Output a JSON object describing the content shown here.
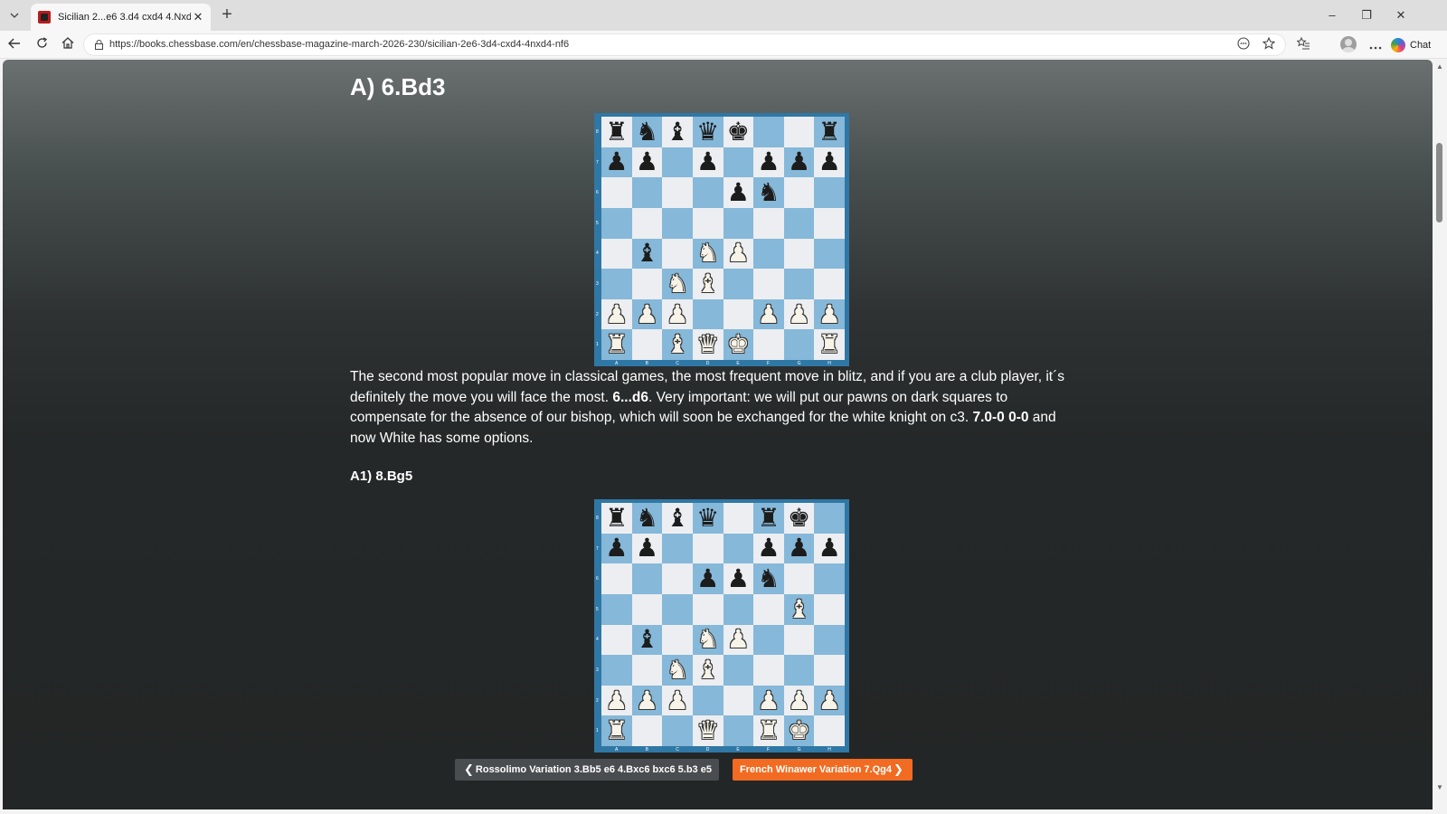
{
  "browser": {
    "tab_title": "Sicilian 2...e6 3.d4 cxd4 4.Nxd4 Nf6",
    "tab_close": "✕",
    "new_tab": "+",
    "url": "https://books.chessbase.com/en/chessbase-magazine-march-2026-230/sicilian-2e6-3d4-cxd4-4nxd4-nf6",
    "copilot_label": "Chat",
    "icons": {
      "tab_menu": "chevron-down-icon",
      "back": "back-arrow-icon",
      "reload": "reload-icon",
      "home": "home-icon",
      "lock": "lock-icon",
      "reader": "reader-mode-icon",
      "favorite": "star-icon",
      "collections": "collections-icon",
      "more": "more-icon"
    },
    "window_controls": {
      "minimize": "–",
      "restore": "❐",
      "close": "✕"
    }
  },
  "article": {
    "section_title": "A) 6.Bd3",
    "paragraph": {
      "part1": "The second most popular move in classical games, the most frequent move in blitz, and if you are a club player, it´s definitely the move you will face the most. ",
      "move1": "6...d6",
      "part2": ". Very important: we will put our pawns on dark squares to compensate for the absence of our bishop, which will soon be exchanged for the white knight on c3. ",
      "move2": "7.0-0 0-0",
      "part3": " and now White has some options."
    },
    "subheading": "A1) 8.Bg5",
    "diagrams": [
      {
        "ranks": [
          "rnbqk2r",
          "pp1p1ppp",
          "4pn2",
          "8",
          "1b1NP3",
          "2NB4",
          "PPP2PPP",
          "R1BQK2R"
        ]
      },
      {
        "ranks": [
          "rnbq1rk1",
          "pp3ppp",
          "3ppn2",
          "6B1",
          "1b1NP3",
          "2NB4",
          "PPP2PPP",
          "R2Q1RK1"
        ]
      }
    ],
    "files": [
      "A",
      "B",
      "C",
      "D",
      "E",
      "F",
      "G",
      "H"
    ],
    "rank_numbers": [
      "8",
      "7",
      "6",
      "5",
      "4",
      "3",
      "2",
      "1"
    ],
    "colors": {
      "light_square": "#eceef1",
      "dark_square": "#86b8d9",
      "board_border": "#2f77a5",
      "next_button": "#f26b22",
      "prev_button": "#4a4d4f"
    }
  },
  "pagination": {
    "prev_label": "Rossolimo Variation 3.Bb5 e6 4.Bxc6 bxc6 5.b3 e5",
    "next_label": "French Winawer Variation 7.Qg4",
    "prev_chevron": "❮",
    "next_chevron": "❯"
  }
}
